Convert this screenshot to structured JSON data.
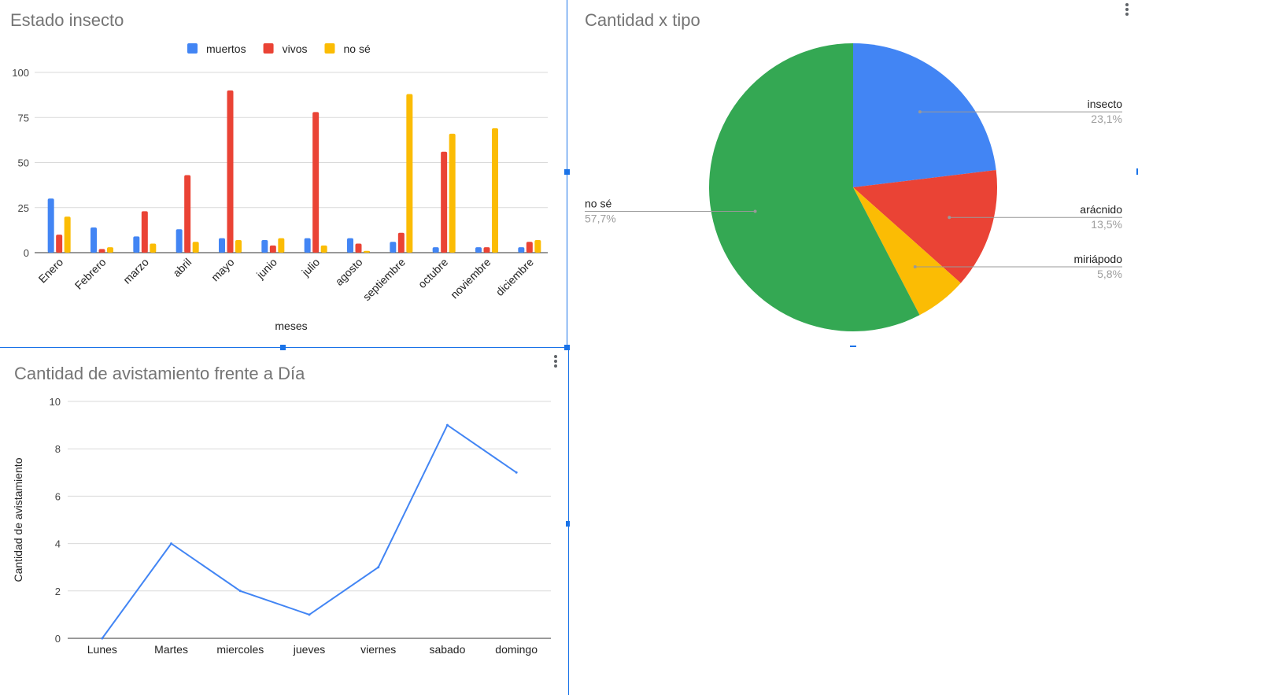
{
  "chart_data": [
    {
      "type": "bar",
      "title": "Estado insecto",
      "xlabel": "meses",
      "ylabel": "",
      "ylim": [
        0,
        100
      ],
      "yticks": [
        0,
        25,
        50,
        75,
        100
      ],
      "legend_position": "top",
      "grid": true,
      "categories": [
        "Enero",
        "Febrero",
        "marzo",
        "abril",
        "mayo",
        "junio",
        "julio",
        "agosto",
        "septiembre",
        "octubre",
        "noviembre",
        "diciembre"
      ],
      "series": [
        {
          "name": "muertos",
          "color": "#4285f4",
          "values": [
            30,
            14,
            9,
            13,
            8,
            7,
            8,
            8,
            6,
            3,
            3,
            3
          ]
        },
        {
          "name": "vivos",
          "color": "#ea4335",
          "values": [
            10,
            2,
            23,
            43,
            90,
            4,
            78,
            5,
            11,
            56,
            3,
            6
          ]
        },
        {
          "name": "no sé",
          "color": "#fbbc04",
          "values": [
            20,
            3,
            5,
            6,
            7,
            8,
            4,
            1,
            88,
            66,
            69,
            7
          ]
        }
      ]
    },
    {
      "type": "pie",
      "title": "Cantidad x tipo",
      "slices": [
        {
          "label": "insecto",
          "percent_label": "23,1%",
          "value": 23.1,
          "color": "#4285f4"
        },
        {
          "label": "arácnido",
          "percent_label": "13,5%",
          "value": 13.5,
          "color": "#ea4335"
        },
        {
          "label": "miriápodo",
          "percent_label": "5,8%",
          "value": 5.8,
          "color": "#fbbc04"
        },
        {
          "label": "no sé",
          "percent_label": "57,7%",
          "value": 57.7,
          "color": "#34a853"
        }
      ]
    },
    {
      "type": "line",
      "title": "Cantidad de avistamiento frente a Día",
      "xlabel": "",
      "ylabel": "Cantidad de avistamiento",
      "ylim": [
        0,
        10
      ],
      "yticks": [
        0,
        2,
        4,
        6,
        8,
        10
      ],
      "grid": true,
      "categories": [
        "Lunes",
        "Martes",
        "miercoles",
        "jueves",
        "viernes",
        "sabado",
        "domingo"
      ],
      "series": [
        {
          "color": "#4285f4",
          "values": [
            0,
            4,
            2,
            1,
            3,
            9,
            7
          ]
        }
      ]
    }
  ]
}
